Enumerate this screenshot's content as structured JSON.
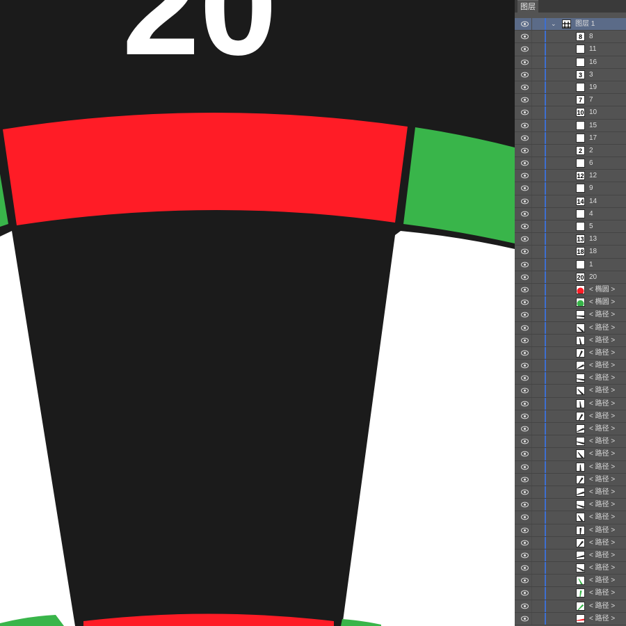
{
  "canvas": {
    "number_label": "20",
    "colors": {
      "black": "#1b1b1b",
      "red": "#ff1c26",
      "green": "#39b54a",
      "white": "#ffffff"
    }
  },
  "panel": {
    "tab_label": "图层",
    "layer": {
      "name": "图层 1"
    },
    "items": [
      {
        "label": "8",
        "thumb": "8"
      },
      {
        "label": "11",
        "thumb": ""
      },
      {
        "label": "16",
        "thumb": ""
      },
      {
        "label": "3",
        "thumb": "3"
      },
      {
        "label": "19",
        "thumb": ""
      },
      {
        "label": "7",
        "thumb": "7"
      },
      {
        "label": "10",
        "thumb": "10"
      },
      {
        "label": "15",
        "thumb": ""
      },
      {
        "label": "17",
        "thumb": ""
      },
      {
        "label": "2",
        "thumb": "2"
      },
      {
        "label": "6",
        "thumb": ""
      },
      {
        "label": "12",
        "thumb": "12"
      },
      {
        "label": "9",
        "thumb": ""
      },
      {
        "label": "14",
        "thumb": "14"
      },
      {
        "label": "4",
        "thumb": ""
      },
      {
        "label": "5",
        "thumb": ""
      },
      {
        "label": "13",
        "thumb": "13"
      },
      {
        "label": "18",
        "thumb": "18"
      },
      {
        "label": "1",
        "thumb": ""
      },
      {
        "label": "20",
        "thumb": "20"
      },
      {
        "label": "< 椭圆 >",
        "thumb": "red-circle"
      },
      {
        "label": "< 椭圆 >",
        "thumb": "green-circle"
      },
      {
        "label": "< 路径 >",
        "thumb": "path"
      },
      {
        "label": "< 路径 >",
        "thumb": "path"
      },
      {
        "label": "< 路径 >",
        "thumb": "path"
      },
      {
        "label": "< 路径 >",
        "thumb": "path"
      },
      {
        "label": "< 路径 >",
        "thumb": "path"
      },
      {
        "label": "< 路径 >",
        "thumb": "path"
      },
      {
        "label": "< 路径 >",
        "thumb": "path"
      },
      {
        "label": "< 路径 >",
        "thumb": "path"
      },
      {
        "label": "< 路径 >",
        "thumb": "path"
      },
      {
        "label": "< 路径 >",
        "thumb": "path"
      },
      {
        "label": "< 路径 >",
        "thumb": "path"
      },
      {
        "label": "< 路径 >",
        "thumb": "path"
      },
      {
        "label": "< 路径 >",
        "thumb": "path"
      },
      {
        "label": "< 路径 >",
        "thumb": "path"
      },
      {
        "label": "< 路径 >",
        "thumb": "path"
      },
      {
        "label": "< 路径 >",
        "thumb": "path"
      },
      {
        "label": "< 路径 >",
        "thumb": "path"
      },
      {
        "label": "< 路径 >",
        "thumb": "path"
      },
      {
        "label": "< 路径 >",
        "thumb": "path"
      },
      {
        "label": "< 路径 >",
        "thumb": "path"
      },
      {
        "label": "< 路径 >",
        "thumb": "path"
      },
      {
        "label": "< 路径 >",
        "thumb": "green-path"
      },
      {
        "label": "< 路径 >",
        "thumb": "green-path"
      },
      {
        "label": "< 路径 >",
        "thumb": "green-path"
      },
      {
        "label": "< 路径 >",
        "thumb": "red-path"
      }
    ]
  }
}
